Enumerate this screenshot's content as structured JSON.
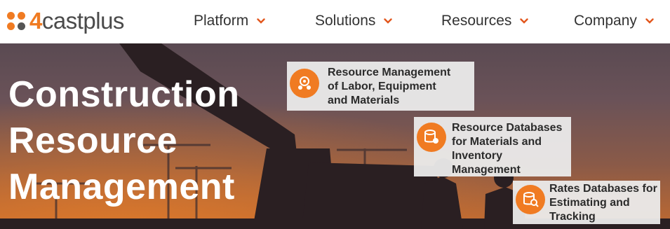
{
  "brand": {
    "logo_num": "4",
    "logo_cast": "cast",
    "logo_plus": "plus"
  },
  "nav": {
    "items": [
      {
        "label": "Platform"
      },
      {
        "label": "Solutions"
      },
      {
        "label": "Resources"
      },
      {
        "label": "Company"
      }
    ]
  },
  "hero": {
    "title_line1": "Construction",
    "title_line2": "Resource",
    "title_line3": "Management"
  },
  "cards": [
    {
      "line1": "Resource Management",
      "line2": "of Labor, Equipment",
      "line3": "and Materials",
      "icon": "people-gear-icon"
    },
    {
      "line1": "Resource Databases",
      "line2": "for Materials and",
      "line3": "Inventory",
      "line4": "Management",
      "icon": "database-gear-icon"
    },
    {
      "line1": "Rates Databases for",
      "line2": "Estimating and",
      "line3": "Tracking",
      "icon": "database-search-icon"
    }
  ],
  "colors": {
    "accent": "#f07b22",
    "nav_text": "#333333",
    "card_bg": "#ebebeb"
  }
}
